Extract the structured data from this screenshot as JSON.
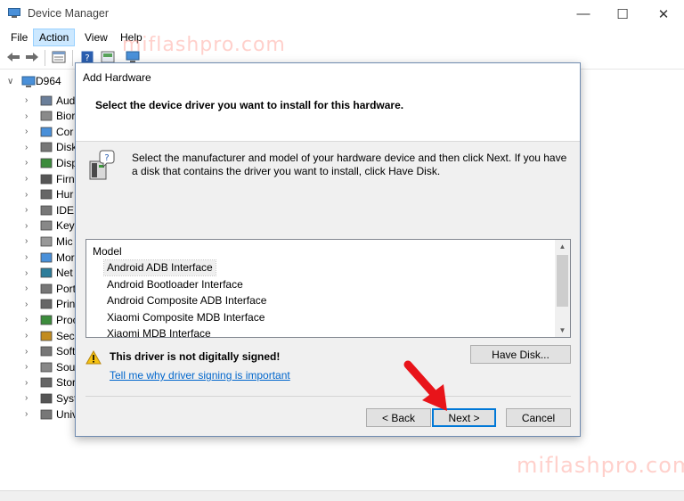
{
  "window": {
    "title": "Device Manager",
    "controls": {
      "minimize": "—",
      "maximize": "☐",
      "close": "✕"
    }
  },
  "menu": [
    "File",
    "Action",
    "View",
    "Help"
  ],
  "active_menu": "Action",
  "tree": {
    "root": "D964",
    "items": [
      {
        "label": "Aud",
        "icon": "audio-icon"
      },
      {
        "label": "Bior",
        "icon": "biometric-icon"
      },
      {
        "label": "Cor",
        "icon": "computer-icon"
      },
      {
        "label": "Disk",
        "icon": "disk-icon"
      },
      {
        "label": "Disp",
        "icon": "display-icon"
      },
      {
        "label": "Firn",
        "icon": "firmware-icon"
      },
      {
        "label": "Hur",
        "icon": "hid-icon"
      },
      {
        "label": "IDE",
        "icon": "ide-icon"
      },
      {
        "label": "Key",
        "icon": "keyboard-icon"
      },
      {
        "label": "Mic",
        "icon": "mouse-icon"
      },
      {
        "label": "Mor",
        "icon": "monitor-icon"
      },
      {
        "label": "Net",
        "icon": "network-icon"
      },
      {
        "label": "Port",
        "icon": "port-icon"
      },
      {
        "label": "Prin",
        "icon": "printer-icon"
      },
      {
        "label": "Proc",
        "icon": "processor-icon"
      },
      {
        "label": "Secu",
        "icon": "security-icon"
      },
      {
        "label": "Soft",
        "icon": "software-icon"
      },
      {
        "label": "Sou",
        "icon": "sound-icon"
      },
      {
        "label": "Stor",
        "icon": "storage-icon"
      },
      {
        "label": "Syst",
        "icon": "system-icon"
      },
      {
        "label": "Univ",
        "icon": "usb-icon"
      }
    ]
  },
  "watermark": "miflashpro.com",
  "dialog": {
    "title": "Add Hardware",
    "heading": "Select the device driver you want to install for this hardware.",
    "intro": "Select the manufacturer and model of your hardware device and then click Next. If you have a disk that contains the driver you want to install, click Have Disk.",
    "list_header": "Model",
    "models": [
      "Android ADB Interface",
      "Android Bootloader Interface",
      "Android Composite ADB Interface",
      "Xiaomi Composite MDB Interface",
      "Xiaomi MDB Interface"
    ],
    "selected_model": "Android ADB Interface",
    "warning": "This driver is not digitally signed!",
    "signing_link": "Tell me why driver signing is important",
    "buttons": {
      "have_disk": "Have Disk...",
      "back": "< Back",
      "next": "Next >",
      "cancel": "Cancel"
    }
  },
  "colors": {
    "accent": "#0078d7",
    "link": "#0066cc",
    "annotation_arrow": "#e8141a",
    "watermark": "#ff968c"
  }
}
